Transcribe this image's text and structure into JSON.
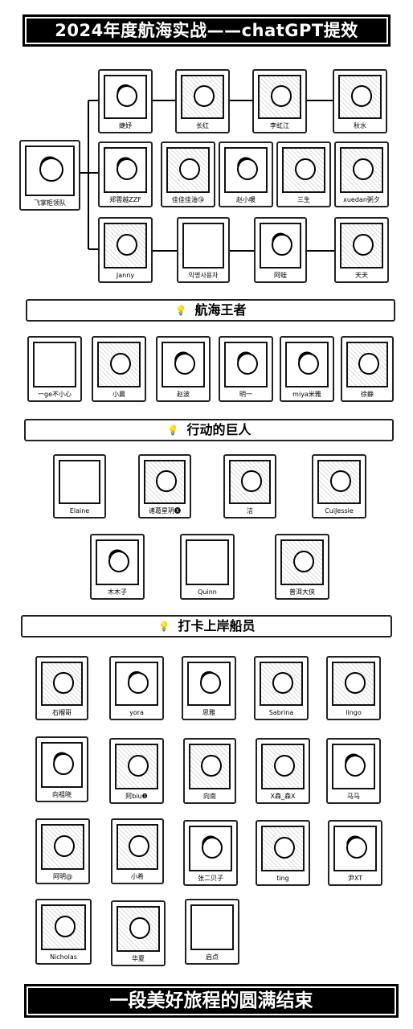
{
  "title": "2024年度航海实战——chatGPT提效",
  "leader": {
    "name": "飞掌柜领队"
  },
  "team_rows": [
    [
      "婕妤",
      "长红",
      "李虹江",
      "秋水"
    ],
    [
      "郑雲越ZZF",
      "佳佳佳油😘",
      "赵小暖",
      "三生",
      "xuedan粥夕"
    ],
    [
      "Janny",
      "익명사용자",
      "阿蛙",
      "天天"
    ]
  ],
  "sections": [
    {
      "title": "航海王者",
      "members": [
        "一ge不小心",
        "小晨",
        "赵波",
        "明一",
        "miya米雅",
        "徐静"
      ]
    },
    {
      "title": "行动的巨人",
      "members": [
        "Elaine",
        "诸葛星玥🅧",
        "洁",
        "CuiJessie",
        "木木子",
        "Quinn",
        "普洱大侠"
      ]
    },
    {
      "title": "打卡上岸船员",
      "members": [
        "石榴哥",
        "yora",
        "思雅",
        "Sabrina",
        "lingo",
        "向祖晓",
        "阿biu❶",
        "向南",
        "X森_森X",
        "马马",
        "阿明@",
        "小希",
        "张二贝子",
        "ting",
        "尹XT",
        "Nicholas",
        "华夏",
        "启点"
      ]
    }
  ],
  "footer": "一段美好旅程的圆满结束",
  "icons": {
    "section_icon": "lightbulb-icon"
  }
}
